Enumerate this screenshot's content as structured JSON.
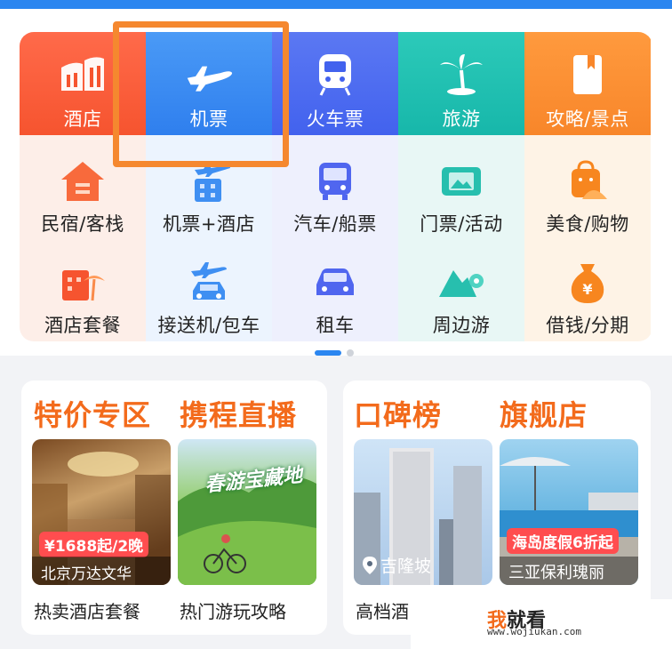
{
  "colors": {
    "hotel": "#f9603f",
    "flight": "#3a8bf0",
    "train": "#4b6bf0",
    "travel": "#20c0b5",
    "guide": "#fa8c32",
    "highlight": "#f5882f",
    "accent": "#f36b1c"
  },
  "main_row": [
    {
      "label": "酒店",
      "icon": "hotel-building-icon"
    },
    {
      "label": "机票",
      "icon": "airplane-icon"
    },
    {
      "label": "火车票",
      "icon": "train-icon"
    },
    {
      "label": "旅游",
      "icon": "palm-tree-icon"
    },
    {
      "label": "攻略/景点",
      "icon": "guidebook-icon"
    }
  ],
  "row2": [
    {
      "label": "民宿/客栈",
      "icon": "house-icon"
    },
    {
      "label": "机票+酒店",
      "icon": "plane-hotel-icon"
    },
    {
      "label": "汽车/船票",
      "icon": "bus-icon"
    },
    {
      "label": "门票/活动",
      "icon": "ticket-icon"
    },
    {
      "label": "美食/购物",
      "icon": "food-shopping-icon"
    }
  ],
  "row3": [
    {
      "label": "酒店套餐",
      "icon": "hotel-package-icon"
    },
    {
      "label": "接送机/包车",
      "icon": "airport-car-icon"
    },
    {
      "label": "租车",
      "icon": "car-rental-icon"
    },
    {
      "label": "周边游",
      "icon": "map-pin-icon"
    },
    {
      "label": "借钱/分期",
      "icon": "money-bag-icon"
    }
  ],
  "pagination": {
    "pages": 2,
    "active": 1
  },
  "promo_left": {
    "title1": "特价专区",
    "title2": "携程直播",
    "card1_price": "¥1688起/2晚",
    "card1_name": "北京万达文华",
    "card1_caption": "热卖酒店套餐",
    "card2_badge": "春游宝藏地",
    "card2_caption": "热门游玩攻略"
  },
  "promo_right": {
    "title1": "口碑榜",
    "title2": "旗舰店",
    "card1_location": "吉隆坡",
    "card1_caption": "高档酒",
    "card2_promo": "海岛度假6折起",
    "card2_name": "三亚保利瑰丽"
  },
  "watermark": {
    "brand_a": "我",
    "brand_b": "就看",
    "url": "www.wojiukan.com"
  }
}
